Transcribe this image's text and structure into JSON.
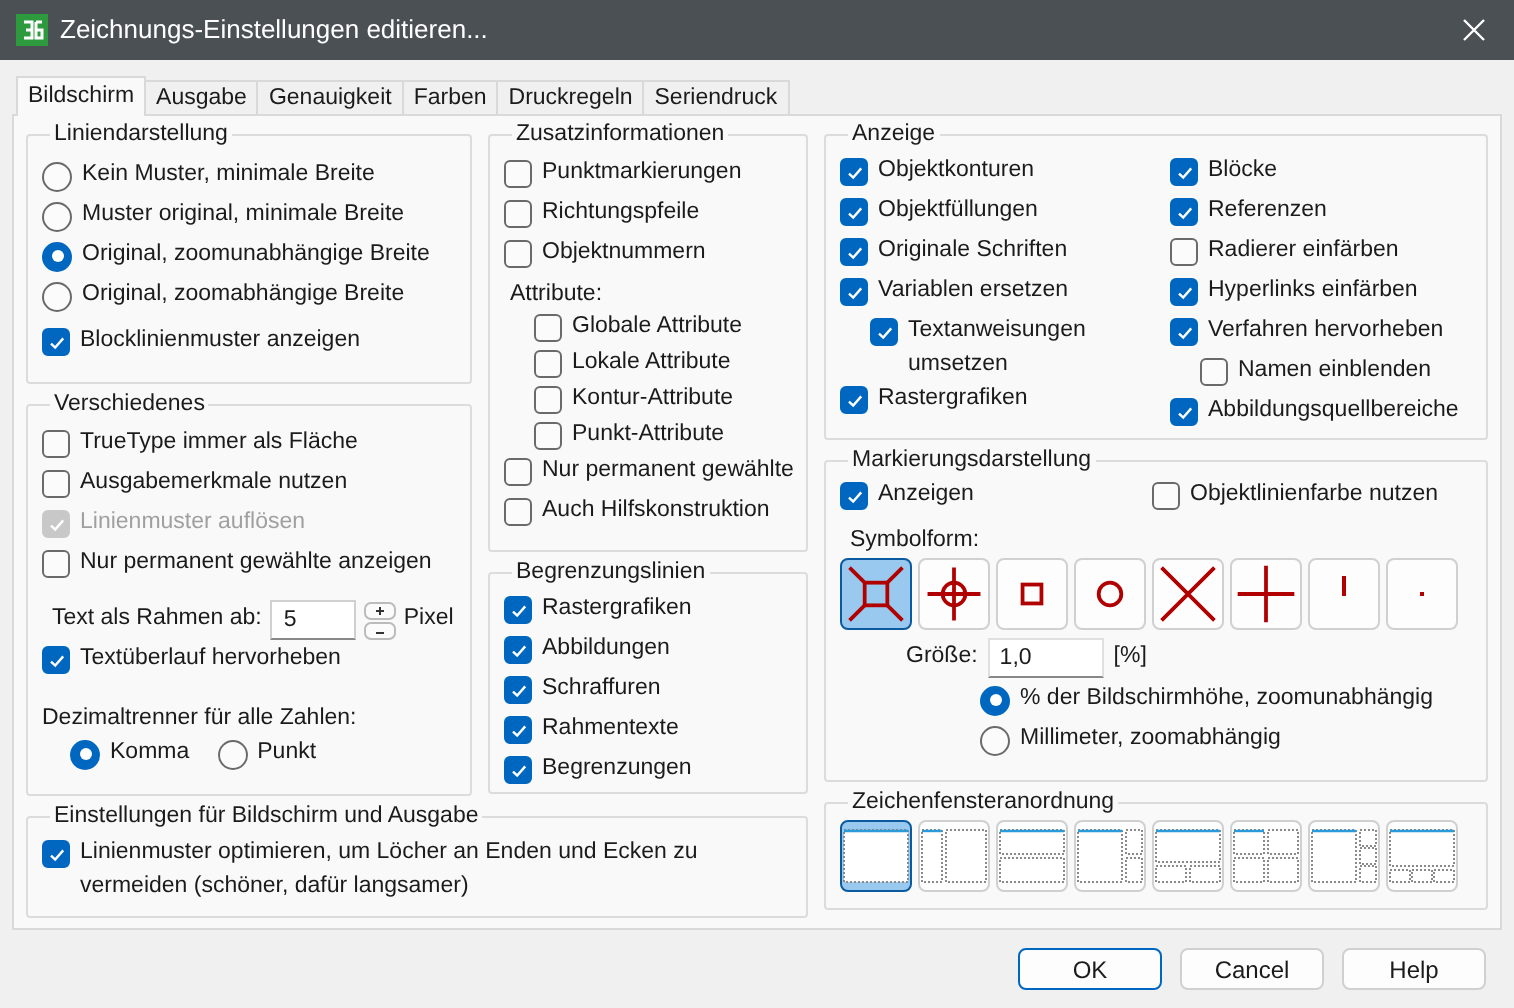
{
  "window": {
    "title": "Zeichnungs-Einstellungen editieren..."
  },
  "tabs": [
    {
      "label": "Bildschirm",
      "selected": true
    },
    {
      "label": "Ausgabe",
      "selected": false
    },
    {
      "label": "Genauigkeit",
      "selected": false
    },
    {
      "label": "Farben",
      "selected": false
    },
    {
      "label": "Druckregeln",
      "selected": false
    },
    {
      "label": "Seriendruck",
      "selected": false
    }
  ],
  "liniendarstellung": {
    "title": "Liniendarstellung",
    "options": [
      {
        "label": "Kein Muster, minimale Breite",
        "selected": false
      },
      {
        "label": "Muster original, minimale Breite",
        "selected": false
      },
      {
        "label": "Original, zoomunabhängige Breite",
        "selected": true
      },
      {
        "label": "Original, zoomabhängige Breite",
        "selected": false
      }
    ],
    "block_pattern": {
      "label": "Blocklinienmuster anzeigen",
      "checked": true
    }
  },
  "verschiedenes": {
    "title": "Verschiedenes",
    "checkboxes": [
      {
        "label": "TrueType immer als Fläche",
        "checked": false,
        "disabled": false
      },
      {
        "label": "Ausgabemerkmale nutzen",
        "checked": false,
        "disabled": false
      },
      {
        "label": "Linienmuster auflösen",
        "checked": true,
        "disabled": true
      },
      {
        "label": "Nur permanent gewählte anzeigen",
        "checked": false,
        "disabled": false
      }
    ],
    "frame_text": {
      "label": "Text als Rahmen ab:",
      "value": "5",
      "unit": "Pixel"
    },
    "overflow": {
      "label": "Textüberlauf hervorheben",
      "checked": true
    },
    "decimal": {
      "label": "Dezimaltrenner für alle Zahlen:",
      "options": [
        {
          "label": "Komma",
          "selected": true
        },
        {
          "label": "Punkt",
          "selected": false
        }
      ]
    }
  },
  "bildschirm_ausgabe": {
    "title": "Einstellungen für Bildschirm und Ausgabe",
    "option": {
      "label": "Linienmuster optimieren, um Löcher an Enden und Ecken zu vermeiden (schöner, dafür langsamer)",
      "checked": true
    }
  },
  "zusatzinformationen": {
    "title": "Zusatzinformationen",
    "checkboxes": [
      {
        "label": "Punktmarkierungen",
        "checked": false
      },
      {
        "label": "Richtungspfeile",
        "checked": false
      },
      {
        "label": "Objektnummern",
        "checked": false
      }
    ],
    "attributes_label": "Attribute:",
    "attributes": [
      {
        "label": "Globale Attribute",
        "checked": false
      },
      {
        "label": "Lokale Attribute",
        "checked": false
      },
      {
        "label": "Kontur-Attribute",
        "checked": false
      },
      {
        "label": "Punkt-Attribute",
        "checked": false
      }
    ],
    "more": [
      {
        "label": "Nur permanent gewählte",
        "checked": false
      },
      {
        "label": "Auch Hilfskonstruktion",
        "checked": false
      }
    ]
  },
  "begrenzungslinien": {
    "title": "Begrenzungslinien",
    "checkboxes": [
      {
        "label": "Rastergrafiken",
        "checked": true
      },
      {
        "label": "Abbildungen",
        "checked": true
      },
      {
        "label": "Schraffuren",
        "checked": true
      },
      {
        "label": "Rahmentexte",
        "checked": true
      },
      {
        "label": "Begrenzungen",
        "checked": true
      }
    ]
  },
  "anzeige": {
    "title": "Anzeige",
    "left": [
      {
        "label": "Objektkonturen",
        "checked": true
      },
      {
        "label": "Objektfüllungen",
        "checked": true
      },
      {
        "label": "Originale Schriften",
        "checked": true
      },
      {
        "label": "Variablen ersetzen",
        "checked": true,
        "children": [
          {
            "label": "Textanweisungen umsetzen",
            "checked": true
          }
        ]
      },
      {
        "label": "Rastergrafiken",
        "checked": true
      }
    ],
    "right": [
      {
        "label": "Blöcke",
        "checked": true
      },
      {
        "label": "Referenzen",
        "checked": true
      },
      {
        "label": "Radierer einfärben",
        "checked": false
      },
      {
        "label": "Hyperlinks einfärben",
        "checked": true
      },
      {
        "label": "Verfahren hervorheben",
        "checked": true,
        "children": [
          {
            "label": "Namen einblenden",
            "checked": false
          }
        ]
      },
      {
        "label": "Abbildungsquellbereiche",
        "checked": true
      }
    ]
  },
  "markierung": {
    "title": "Markierungsdarstellung",
    "show": {
      "label": "Anzeigen",
      "checked": true
    },
    "object_color": {
      "label": "Objektlinienfarbe nutzen",
      "checked": false
    },
    "symbol_label": "Symbolform:",
    "symbols": [
      {
        "kind": "boxcross",
        "selected": true
      },
      {
        "kind": "crosshair",
        "selected": false
      },
      {
        "kind": "square",
        "selected": false
      },
      {
        "kind": "circle",
        "selected": false
      },
      {
        "kind": "cross",
        "selected": false
      },
      {
        "kind": "plus",
        "selected": false
      },
      {
        "kind": "tick",
        "selected": false
      },
      {
        "kind": "dot",
        "selected": false
      }
    ],
    "size": {
      "label": "Größe:",
      "value": "1,0",
      "unit": "[%]"
    },
    "units": [
      {
        "label": "% der Bildschirmhöhe, zoomunabhängig",
        "selected": true
      },
      {
        "label": "Millimeter, zoomabhängig",
        "selected": false
      }
    ]
  },
  "zeichenfenster": {
    "title": "Zeichenfensteranordnung",
    "layouts": [
      {
        "kind": "single",
        "selected": true
      },
      {
        "kind": "columns",
        "selected": false
      },
      {
        "kind": "rows",
        "selected": false
      },
      {
        "kind": "right2",
        "selected": false
      },
      {
        "kind": "bottom2",
        "selected": false
      },
      {
        "kind": "quad",
        "selected": false
      },
      {
        "kind": "right3",
        "selected": false
      },
      {
        "kind": "bottom3",
        "selected": false
      }
    ]
  },
  "buttons": [
    {
      "label": "OK",
      "default": true
    },
    {
      "label": "Cancel",
      "default": false
    },
    {
      "label": "Help",
      "default": false
    }
  ]
}
